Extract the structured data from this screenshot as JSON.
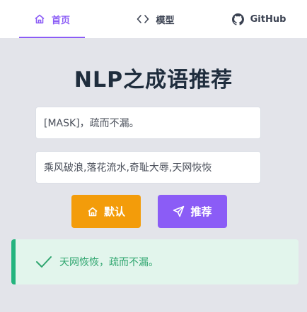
{
  "nav": {
    "tabs": [
      {
        "label": "首页",
        "icon": "home-icon",
        "active": true
      },
      {
        "label": "模型",
        "icon": "code-icon",
        "active": false
      },
      {
        "label": "GitHub",
        "icon": "github-icon",
        "active": false
      }
    ]
  },
  "page_title": "NLP之成语推荐",
  "form": {
    "mask_input_value": "[MASK]，疏而不漏。",
    "candidates_input_value": "乘风破浪,落花流水,奇耻大辱,天网恢恢"
  },
  "buttons": {
    "default_label": "默认",
    "default_icon": "home-icon",
    "recommend_label": "推荐",
    "recommend_icon": "send-icon"
  },
  "result": {
    "text": "天网恢恢，疏而不漏。",
    "icon": "check-icon"
  },
  "colors": {
    "accent": "#8b5cf6",
    "warning": "#f39c0a",
    "success": "#24b47e",
    "background": "#e3e4ea"
  }
}
